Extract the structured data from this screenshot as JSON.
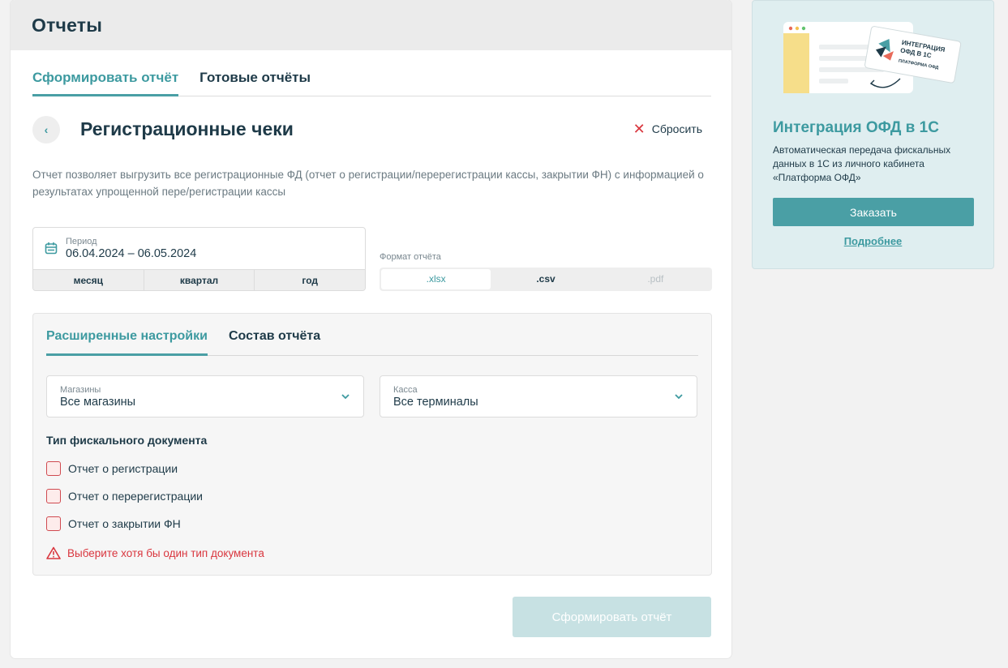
{
  "header": {
    "title": "Отчеты"
  },
  "tabs": [
    {
      "label": "Сформировать  отчёт",
      "active": true
    },
    {
      "label": "Готовые отчёты",
      "active": false
    }
  ],
  "report": {
    "title": "Регистрационные чеки",
    "reset_label": "Сбросить",
    "description": "Отчет позволяет выгрузить все регистрационные ФД (отчет о регистрации/перерегистрации кассы, закрытии ФН) с информацией о результатах упрощенной пере/регистрации кассы"
  },
  "period": {
    "label": "Период",
    "value": "06.04.2024 – 06.05.2024",
    "quick": [
      "месяц",
      "квартал",
      "год"
    ]
  },
  "format": {
    "label": "Формат отчёта",
    "options": [
      ".xlsx",
      ".csv",
      ".pdf"
    ],
    "selected": ".xlsx",
    "disabled": ".pdf"
  },
  "settings": {
    "tabs": [
      {
        "label": "Расширенные настройки",
        "active": true
      },
      {
        "label": "Состав отчёта",
        "active": false
      }
    ],
    "stores": {
      "label": "Магазины",
      "value": "Все магазины"
    },
    "kassa": {
      "label": "Касса",
      "value": "Все терминалы"
    },
    "doc_type_title": "Тип фискального документа",
    "doc_types": [
      "Отчет о регистрации",
      "Отчет о перерегистрации",
      "Отчет о закрытии ФН"
    ],
    "error": "Выберите хотя бы один тип документа"
  },
  "submit_label": "Сформировать отчёт",
  "promo": {
    "badge_lines": [
      "ИНТЕГРАЦИЯ",
      "ОФД В 1С",
      "ПЛАТФОРМА ОФД"
    ],
    "title": "Интеграция ОФД в 1С",
    "text": "Автоматическая передача фискальных данных в 1С из личного кабинета «Платформа ОФД»",
    "button_label": "Заказать",
    "link_label": "Подробнее"
  },
  "colors": {
    "accent": "#4a9fa5",
    "error": "#d9363e",
    "text": "#1e3a48"
  }
}
